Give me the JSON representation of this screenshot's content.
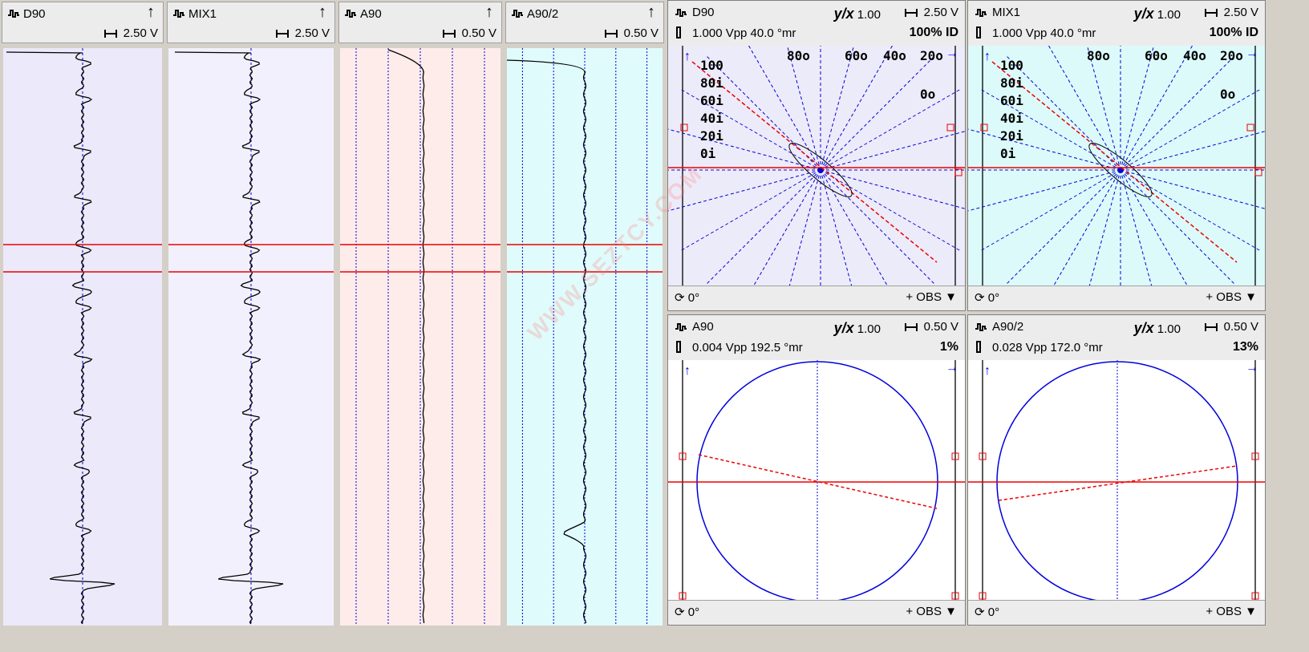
{
  "strips": [
    {
      "name": "D90",
      "scale": "2.50 V",
      "bg": "#ebe9fa"
    },
    {
      "name": "MIX1",
      "scale": "2.50 V",
      "bg": "#f1f0fc"
    },
    {
      "name": "A90",
      "scale": "0.50 V",
      "bg": "#fdecea"
    },
    {
      "name": "A90/2",
      "scale": "0.50 V",
      "bg": "#e0fbfb"
    }
  ],
  "lissajous": [
    {
      "name": "D90",
      "yx": "1.00",
      "scale": "2.50 V",
      "vpp": "1.000 Vpp  40.0 °mr",
      "pct": "100% ID",
      "rot": "0°",
      "obs": "+  OBS",
      "bg": "#ecebf9"
    },
    {
      "name": "MIX1",
      "yx": "1.00",
      "scale": "2.50 V",
      "vpp": "1.000 Vpp  40.0 °mr",
      "pct": "100% ID",
      "rot": "0°",
      "obs": "+  OBS",
      "bg": "#dcfafa"
    },
    {
      "name": "A90",
      "yx": "1.00",
      "scale": "0.50 V",
      "vpp": "0.004 Vpp 192.5 °mr",
      "pct": "1%",
      "rot": "0°",
      "obs": "+  OBS",
      "bg": "#ffffff"
    },
    {
      "name": "A90/2",
      "yx": "1.00",
      "scale": "0.50 V",
      "vpp": "0.028 Vpp 172.0 °mr",
      "pct": "13%",
      "rot": "0°",
      "obs": "+  OBS",
      "bg": "#ffffff"
    }
  ],
  "depth_labels_od": [
    "80o",
    "60o",
    "40o",
    "20o",
    "0o"
  ],
  "depth_labels_id": [
    "100",
    "80i",
    "60i",
    "40i",
    "20i",
    "0i"
  ],
  "watermark": "WWW.SEZTCY.COM",
  "colors": {
    "trace": "#000000",
    "grid": "#0000dd",
    "cursor": "#ee0000"
  },
  "icons": {
    "signal": "signal-icon",
    "up": "up-arrow-icon",
    "range": "range-icon",
    "probe": "probe-icon",
    "rotate": "rotate-icon",
    "dropdown": "dropdown-icon"
  }
}
